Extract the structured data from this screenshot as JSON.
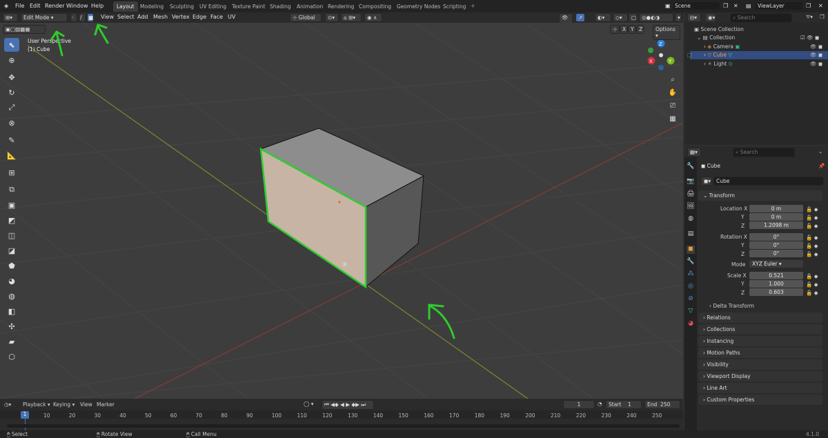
{
  "menu": [
    "File",
    "Edit",
    "Render",
    "Window",
    "Help"
  ],
  "workspaces": [
    "Layout",
    "Modeling",
    "Sculpting",
    "UV Editing",
    "Texture Paint",
    "Shading",
    "Animation",
    "Rendering",
    "Compositing",
    "Geometry Nodes",
    "Scripting"
  ],
  "active_workspace": "Layout",
  "scene": "Scene",
  "view_layer": "ViewLayer",
  "header": {
    "mode": "Edit Mode",
    "menus": [
      "View",
      "Select",
      "Add",
      "Mesh",
      "Vertex",
      "Edge",
      "Face",
      "UV"
    ],
    "orientation": "Global",
    "options": "Options",
    "xyz": [
      "X",
      "Y",
      "Z"
    ]
  },
  "viewport": {
    "perspective": "User Perspective",
    "object": "(1) Cube"
  },
  "gizmo": {
    "x": "X",
    "y": "Y",
    "z": "Z"
  },
  "outliner": {
    "search_placeholder": "Search",
    "items": [
      "Scene Collection",
      "Collection",
      "Camera",
      "Cube",
      "Light"
    ]
  },
  "properties": {
    "search_placeholder": "Search",
    "object_name": "Cube",
    "data_name": "Cube",
    "transform_label": "Transform",
    "location_label": "Location X",
    "y_label": "Y",
    "z_label": "Z",
    "location": [
      "0 m",
      "0 m",
      "1.2098 m"
    ],
    "rotation_label": "Rotation X",
    "rotation": [
      "0°",
      "0°",
      "0°"
    ],
    "mode_label": "Mode",
    "mode_value": "XYZ Euler",
    "scale_label": "Scale X",
    "scale": [
      "0.521",
      "1.000",
      "0.603"
    ],
    "delta": "Delta Transform",
    "panels": [
      "Relations",
      "Collections",
      "Instancing",
      "Motion Paths",
      "Visibility",
      "Viewport Display",
      "Line Art",
      "Custom Properties"
    ]
  },
  "timeline": {
    "menus": [
      "Playback",
      "Keying",
      "View",
      "Marker"
    ],
    "current_frame": "1",
    "start_label": "Start",
    "start": "1",
    "end_label": "End",
    "end": "250",
    "ticks": [
      "1",
      "10",
      "20",
      "30",
      "40",
      "50",
      "60",
      "70",
      "80",
      "90",
      "100",
      "110",
      "120",
      "130",
      "140",
      "150",
      "160",
      "170",
      "180",
      "190",
      "200",
      "210",
      "220",
      "230",
      "240",
      "250"
    ]
  },
  "status": [
    "Select",
    "Rotate View",
    "Call Menu"
  ],
  "version": "4.1.0",
  "colors": {
    "accent": "#4772b3",
    "selection": "#2ecc2e",
    "face": "#c8b4a4"
  }
}
